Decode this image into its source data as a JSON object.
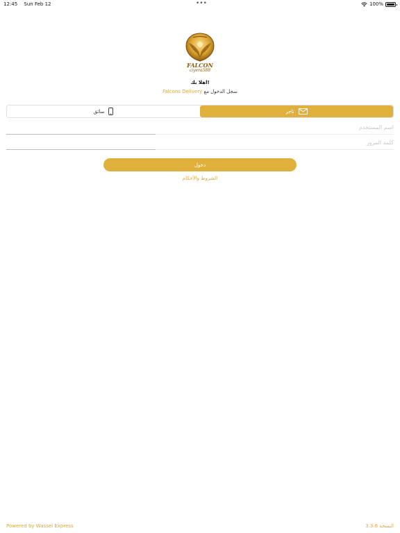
{
  "status_bar": {
    "time": "12:45",
    "date": "Sun Feb 12",
    "battery": "100%",
    "battery_level": 1.0
  },
  "logo": {
    "name": "FALCON",
    "tagline": "ciyera588",
    "alt": "Falcons logo"
  },
  "welcome": {
    "title": "اهلا بك!",
    "login_prefix": "سجل الدخول مع",
    "brand": "Falcons Delivery"
  },
  "user_type": {
    "driver_label": "سائق",
    "merchant_label": "تاجر",
    "selected": "merchant"
  },
  "form": {
    "username_placeholder": "اسم المستخدم",
    "password_placeholder": "كلمة المرور",
    "login_label": "دخول",
    "terms_label": "الشروط والأحكام"
  },
  "footer": {
    "powered_by": "Powered by Wassel Express",
    "version": "النسخة 3.3.6"
  },
  "colors": {
    "accent": "#e0b03c",
    "link": "#d9a83a"
  },
  "icons": {
    "driver": "phone-icon",
    "merchant": "envelope-icon",
    "wifi": "wifi-icon",
    "battery": "battery-icon"
  }
}
